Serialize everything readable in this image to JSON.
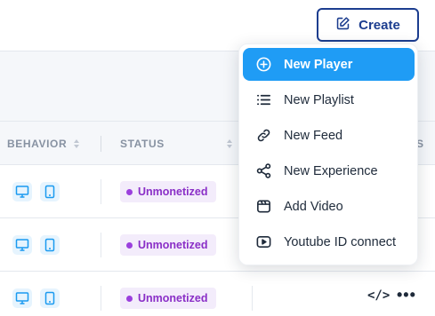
{
  "header": {
    "create_label": "Create"
  },
  "table": {
    "columns": {
      "behavior": "BEHAVIOR",
      "status": "STATUS",
      "right_partial": "S"
    },
    "rows": [
      {
        "status": "Unmonetized"
      },
      {
        "status": "Unmonetized"
      },
      {
        "status": "Unmonetized"
      }
    ],
    "actions": {
      "embed_label": "</>",
      "more_label": "•••"
    }
  },
  "create_menu": {
    "items": [
      {
        "label": "New Player",
        "icon": "plus-circle-icon",
        "active": true
      },
      {
        "label": "New Playlist",
        "icon": "list-icon"
      },
      {
        "label": "New Feed",
        "icon": "link-icon"
      },
      {
        "label": "New Experience",
        "icon": "share-icon"
      },
      {
        "label": "Add Video",
        "icon": "video-icon"
      },
      {
        "label": "Youtube ID connect",
        "icon": "play-icon"
      }
    ]
  },
  "colors": {
    "accent": "#1f9cf5",
    "brand": "#1c3d8f",
    "status_purple": "#8a2fc7",
    "status_bg": "#f3ecfb",
    "device_icon": "#1a9af0"
  }
}
